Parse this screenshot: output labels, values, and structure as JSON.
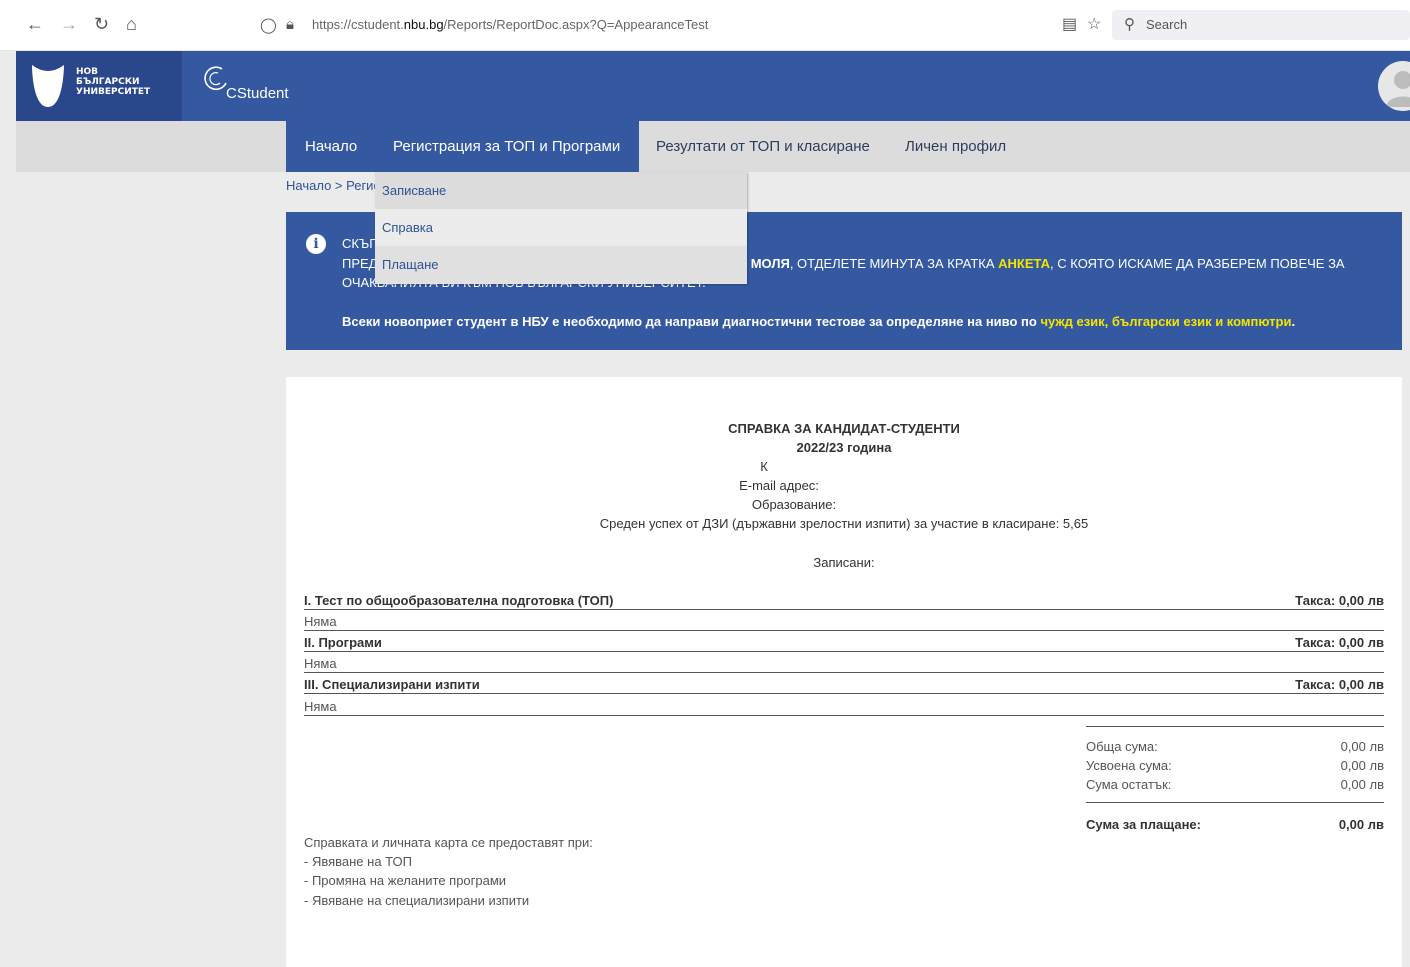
{
  "browser": {
    "url_prefix": "https://cstudent.",
    "url_domain": "nbu.bg",
    "url_path": "/Reports/ReportDoc.aspx?Q=AppearanceTest",
    "search_placeholder": "Search"
  },
  "header": {
    "logo_line1": "НОВ",
    "logo_line2": "БЪЛГАРСКИ",
    "logo_line3": "УНИВЕРСИТЕТ",
    "app_name": "CStudent"
  },
  "menu": {
    "items": [
      {
        "label": "Начало"
      },
      {
        "label": "Регистрация за ТОП и Програми"
      },
      {
        "label": "Резултати от ТОП и класиране"
      },
      {
        "label": "Личен профил"
      }
    ]
  },
  "dropdown": {
    "items": [
      {
        "label": "Записване"
      },
      {
        "label": "Справка"
      },
      {
        "label": "Плащане"
      }
    ]
  },
  "breadcrumb": "Начало > Регис",
  "banner": {
    "line1": "СКЪП",
    "line2_a": "ПРЕД",
    "line2_b": ", МОЛЯ",
    "line2_c": ", ОТДЕЛЕТЕ МИНУТА ЗА КРАТКА ",
    "line2_d": "АНКЕТА",
    "line2_e": ", С КОЯТО ИСКАМЕ ДА РАЗБЕРЕМ ПОВЕЧЕ ЗА",
    "line3": "ОЧАКВАНИЯТА ВИ КЪМ НОВ БЪЛГАРСКИ УНИВЕРСИТЕТ.",
    "line4_a": "Всеки новоприет студент в НБУ е необходимо да направи диагностични тестове за определяне на ниво по ",
    "line4_b": "чужд език, български език и компютри",
    "line4_c": "."
  },
  "report": {
    "title": "СПРАВКА ЗА КАНДИДАТ-СТУДЕНТИ",
    "year": "2022/23 година",
    "name_initial": "К",
    "email_label": "E-mail адрес:",
    "education_label": "Образование:",
    "avg_grade": "Среден успех от ДЗИ (държавни зрелостни изпити) за участие в класиране: 5,65",
    "enrolled_label": "Записани:",
    "sections": [
      {
        "title": "I. Тест по общообразователна подготовка (ТОП)",
        "fee": "Такса: 0,00 лв",
        "value": "Няма"
      },
      {
        "title": "II. Програми",
        "fee": "Такса: 0,00 лв",
        "value": "Няма"
      },
      {
        "title": "III. Специализирани изпити",
        "fee": "Такса: 0,00 лв",
        "value": "Няма"
      }
    ],
    "summary": {
      "total_label": "Обща сума:",
      "total_value": "0,00 лв",
      "absorbed_label": "Усвоена сума:",
      "absorbed_value": "0,00 лв",
      "remainder_label": "Сума остатък:",
      "remainder_value": "0,00 лв",
      "pay_label": "Сума за плащане:",
      "pay_value": "0,00 лв"
    },
    "notes": [
      "Справката и личната карта се предоставят при:",
      "- Явяване на ТОП",
      "- Промяна на желаните програми",
      "- Явяване на специализирани изпити"
    ]
  }
}
